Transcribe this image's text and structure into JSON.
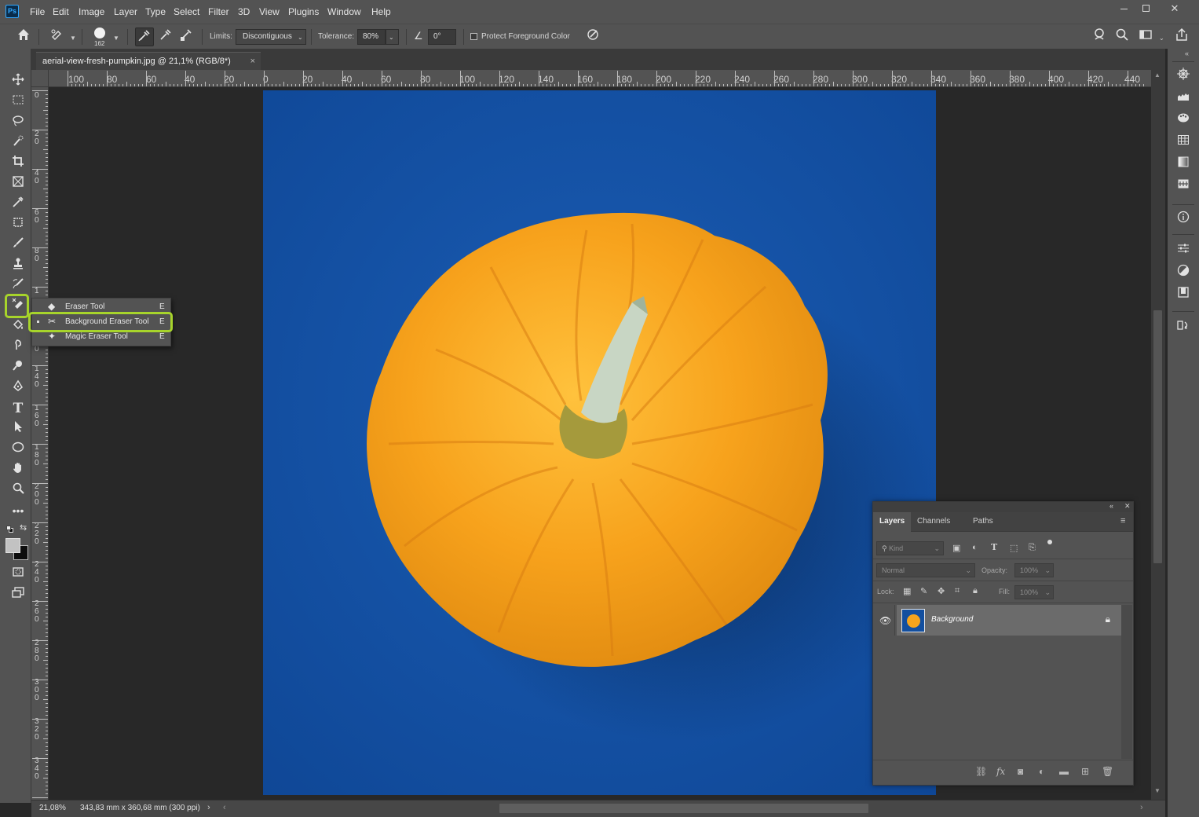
{
  "app": {
    "logo": "Ps"
  },
  "menu": [
    "File",
    "Edit",
    "Image",
    "Layer",
    "Type",
    "Select",
    "Filter",
    "3D",
    "View",
    "Plugins",
    "Window",
    "Help"
  ],
  "window_controls": {
    "minimize": "—",
    "maximize": "□",
    "close": "✕"
  },
  "options_bar": {
    "brush_size": "162",
    "limits_label": "Limits:",
    "limits_value": "Discontiguous",
    "tolerance_label": "Tolerance:",
    "tolerance_value": "80%",
    "angle_value": "0°",
    "protect_label": "Protect Foreground Color"
  },
  "document_tab": {
    "title": "aerial-view-fresh-pumpkin.jpg @ 21,1% (RGB/8*)",
    "close": "×"
  },
  "ruler_h_labels": [
    "100",
    "80",
    "60",
    "40",
    "20",
    "0",
    "20",
    "40",
    "60",
    "80",
    "100",
    "120",
    "140",
    "160",
    "180",
    "200",
    "220",
    "240",
    "260",
    "280",
    "300",
    "320",
    "340",
    "360",
    "380",
    "400",
    "420",
    "440"
  ],
  "ruler_v_labels": [
    "0",
    "20",
    "40",
    "60",
    "80",
    "1",
    "0",
    "140",
    "160",
    "180",
    "200",
    "220",
    "240",
    "260",
    "280",
    "300",
    "320",
    "340"
  ],
  "tool_flyout": [
    {
      "label": "Eraser Tool",
      "shortcut": "E",
      "selected": false
    },
    {
      "label": "Background Eraser Tool",
      "shortcut": "E",
      "selected": true
    },
    {
      "label": "Magic Eraser Tool",
      "shortcut": "E",
      "selected": false
    }
  ],
  "layers_panel": {
    "tabs": [
      "Layers",
      "Channels",
      "Paths"
    ],
    "active_tab": "Layers",
    "kind_placeholder": "Kind",
    "blend_mode": "Normal",
    "opacity_label": "Opacity:",
    "opacity_value": "100%",
    "lock_label": "Lock:",
    "fill_label": "Fill:",
    "fill_value": "100%",
    "layers": [
      {
        "name": "Background",
        "visible": true,
        "locked": true
      }
    ]
  },
  "status": {
    "zoom": "21,08%",
    "doc_info": "343,83 mm x 360,68 mm (300 ppi)"
  },
  "colors": {
    "chrome": "#535353",
    "canvas_bg": "#282828",
    "highlight": "#a7d42b",
    "photo_blue": "#134f9f",
    "pumpkin": "#f2a11c"
  }
}
